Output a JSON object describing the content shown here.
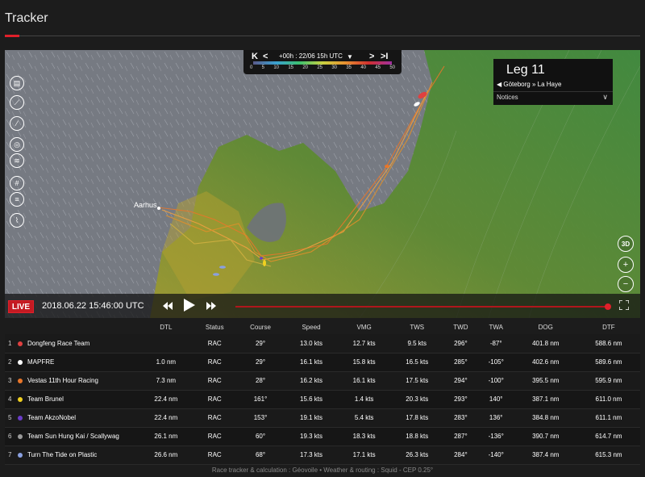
{
  "page": {
    "title": "Tracker"
  },
  "timebar": {
    "label": "+00h : 22/06 15h UTC",
    "scale_ticks": [
      "0",
      "5",
      "10",
      "15",
      "20",
      "25",
      "30",
      "35",
      "40",
      "45",
      "50"
    ]
  },
  "leg": {
    "title": "Leg 11",
    "route": "◀  Göteborg » La Haye",
    "notices": "Notices"
  },
  "map": {
    "city": "Aarhus",
    "tools": [
      "layers-icon",
      "route-icon",
      "ruler-icon",
      "compass-icon",
      "wind-icon",
      "grid-icon",
      "waves-icon",
      "chart-icon"
    ],
    "controls": {
      "three_d": "3D",
      "zoom_in": "+",
      "zoom_out": "−"
    }
  },
  "playback": {
    "live": "LIVE",
    "datetime": "2018.06.22  15:46:00 UTC",
    "progress": 1.0
  },
  "table": {
    "columns": [
      "",
      "",
      "DTL",
      "Status",
      "Course",
      "Speed",
      "VMG",
      "TWS",
      "TWD",
      "TWA",
      "DOG",
      "DTF"
    ],
    "rows": [
      {
        "rank": "1",
        "team": "Dongfeng Race Team",
        "color": "#e04040",
        "dtl": "",
        "status": "RAC",
        "course": "29°",
        "speed": "13.0 kts",
        "vmg": "12.7 kts",
        "tws": "9.5 kts",
        "twd": "296°",
        "twa": "-87°",
        "dog": "401.8 nm",
        "dtf": "588.6 nm"
      },
      {
        "rank": "2",
        "team": "MAPFRE",
        "color": "#ffffff",
        "dtl": "1.0 nm",
        "status": "RAC",
        "course": "29°",
        "speed": "16.1 kts",
        "vmg": "15.8 kts",
        "tws": "16.5 kts",
        "twd": "285°",
        "twa": "-105°",
        "dog": "402.6 nm",
        "dtf": "589.6 nm"
      },
      {
        "rank": "3",
        "team": "Vestas 11th Hour Racing",
        "color": "#e8762a",
        "dtl": "7.3 nm",
        "status": "RAC",
        "course": "28°",
        "speed": "16.2 kts",
        "vmg": "16.1 kts",
        "tws": "17.5 kts",
        "twd": "294°",
        "twa": "-100°",
        "dog": "395.5 nm",
        "dtf": "595.9 nm"
      },
      {
        "rank": "4",
        "team": "Team Brunel",
        "color": "#f0d020",
        "dtl": "22.4 nm",
        "status": "RAC",
        "course": "161°",
        "speed": "15.6 kts",
        "vmg": "1.4 kts",
        "tws": "20.3 kts",
        "twd": "293°",
        "twa": "140°",
        "dog": "387.1 nm",
        "dtf": "611.0 nm"
      },
      {
        "rank": "5",
        "team": "Team AkzoNobel",
        "color": "#6a3cc8",
        "dtl": "22.4 nm",
        "status": "RAC",
        "course": "153°",
        "speed": "19.1 kts",
        "vmg": "5.4 kts",
        "tws": "17.8 kts",
        "twd": "283°",
        "twa": "136°",
        "dog": "384.8 nm",
        "dtf": "611.1 nm"
      },
      {
        "rank": "6",
        "team": "Team Sun Hung Kai / Scallywag",
        "color": "#9a9a9a",
        "dtl": "26.1 nm",
        "status": "RAC",
        "course": "60°",
        "speed": "19.3 kts",
        "vmg": "18.3 kts",
        "tws": "18.8 kts",
        "twd": "287°",
        "twa": "-136°",
        "dog": "390.7 nm",
        "dtf": "614.7 nm"
      },
      {
        "rank": "7",
        "team": "Turn The Tide on Plastic",
        "color": "#8aa0e0",
        "dtl": "26.6 nm",
        "status": "RAC",
        "course": "68°",
        "speed": "17.3 kts",
        "vmg": "17.1 kts",
        "tws": "26.3 kts",
        "twd": "284°",
        "twa": "-140°",
        "dog": "387.4 nm",
        "dtf": "615.3 nm"
      }
    ]
  },
  "footer": "Race tracker & calculation : Géovoile • Weather & routing : Squid - CEP 0.25°"
}
